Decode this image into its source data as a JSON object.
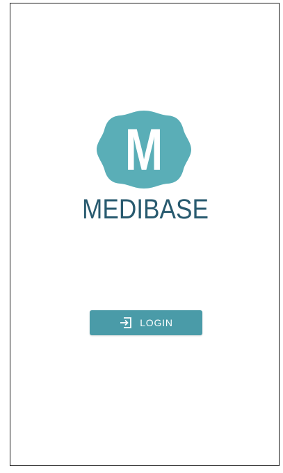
{
  "app": {
    "brand_letter": "M",
    "brand_name": "MEDIBASE"
  },
  "login": {
    "label": "LOGIN",
    "icon": "login-icon"
  },
  "colors": {
    "badge": "#5aaeb7",
    "brand_text": "#285a6f",
    "button": "#4a9ba8"
  }
}
